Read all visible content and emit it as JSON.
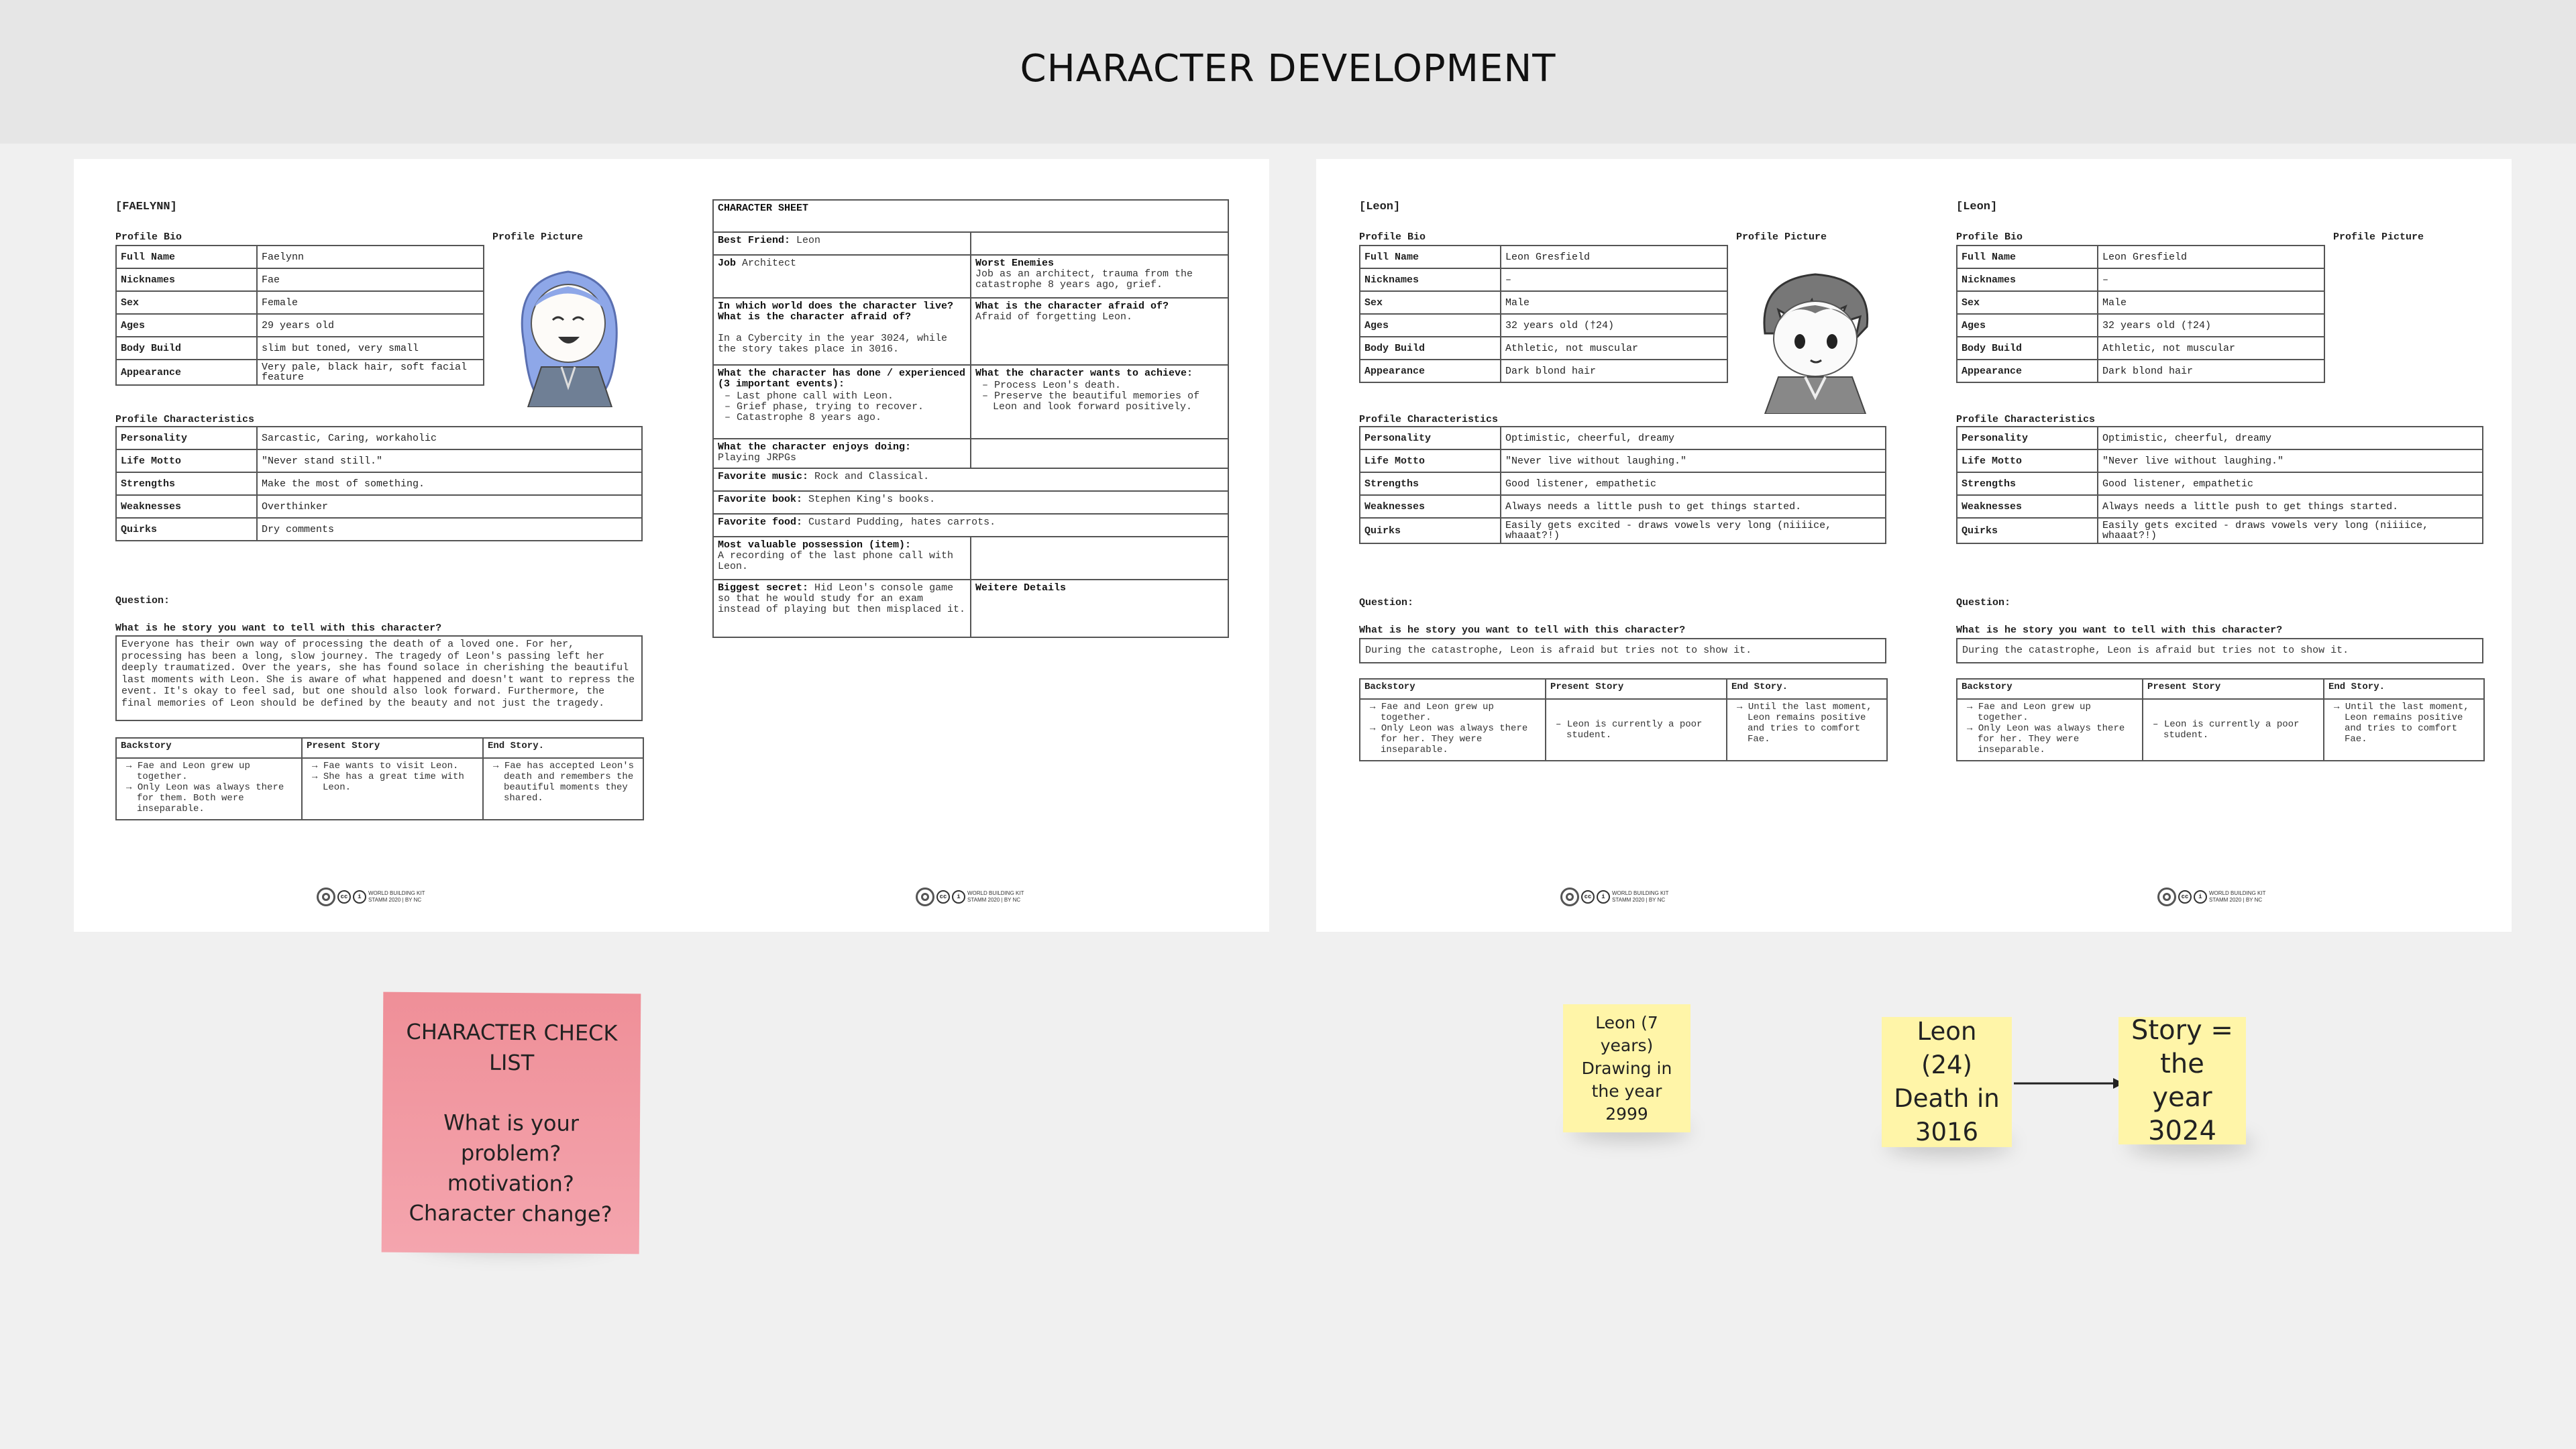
{
  "frame": {
    "title": "CHARACTER DEVELOPMENT"
  },
  "colors": {
    "sticky_pink": "#ef9aa3",
    "sticky_yellow": "#fff5a8",
    "header_bg": "#e6e6e6",
    "canvas_bg": "#f0f0f0"
  },
  "faelynn": {
    "tag": "[FAELYNN]",
    "profile_bio": "Profile Bio",
    "profile_picture": "Profile Picture",
    "bio": [
      {
        "k": "Full Name",
        "v": "Faelynn"
      },
      {
        "k": "Nicknames",
        "v": "Fae"
      },
      {
        "k": "Sex",
        "v": "Female"
      },
      {
        "k": "Ages",
        "v": "29 years old"
      },
      {
        "k": "Body Build",
        "v": "slim but toned, very small"
      },
      {
        "k": "Appearance",
        "v": "Very pale, black hair, soft facial feature"
      }
    ],
    "characteristics_label": "Profile Characteristics",
    "characteristics": [
      {
        "k": "Personality",
        "v": "Sarcastic, Caring, workaholic"
      },
      {
        "k": "Life Motto",
        "v": "\"Never stand still.\""
      },
      {
        "k": "Strengths",
        "v": "Make the most of something."
      },
      {
        "k": "Weaknesses",
        "v": "Overthinker"
      },
      {
        "k": "Quirks",
        "v": "Dry comments"
      }
    ],
    "question_label": "Question:",
    "question": "What is he story you want to tell with this character?",
    "answer": "Everyone has their own way of processing the death of a loved one. For her, processing has been a long, slow journey. The tragedy of Leon's passing left her deeply traumatized. Over the years, she has found solace in cherishing the beautiful last moments with Leon. She is aware of what happened and doesn't want to repress the event. It's okay to feel sad, but one should also look forward. Furthermore, the final memories of Leon should be defined by the beauty and not just the tragedy.",
    "story_headers": [
      "Backstory",
      "Present Story",
      "End Story."
    ],
    "backstory": [
      "Fae and Leon grew up together.",
      "Only Leon was always there for them. Both were inseparable."
    ],
    "present": [
      "Fae wants to visit Leon.",
      "She has a great time with Leon."
    ],
    "end": [
      "Fae has accepted Leon's death and remembers the beautiful moments they shared."
    ]
  },
  "sheet": {
    "title": "CHARACTER SHEET",
    "best_friend_k": "Best Friend:",
    "best_friend_v": "Leon",
    "job_k": "Job",
    "job_v": "Architect",
    "enemies_k": "Worst Enemies",
    "enemies_v": "Job as an architect, trauma from the catastrophe 8 years ago, grief.",
    "world_k": "In which world does the character live? What is the character afraid of?",
    "world_v": "In a Cybercity in the year 3024, while the story takes place in 3016.",
    "afraid_k": "What is the character afraid of?",
    "afraid_v": "Afraid of forgetting Leon.",
    "done_k": "What the character has done / experienced (3 important events):",
    "done_items": [
      "Last phone call with Leon.",
      "Grief phase, trying to recover.",
      "Catastrophe 8 years ago."
    ],
    "achieve_k": "What the character wants to achieve:",
    "achieve_items": [
      "Process Leon's death.",
      "Preserve the beautiful memories of Leon and look forward positively."
    ],
    "enjoys_k": "What the character enjoys doing:",
    "enjoys_v": "Playing JRPGs",
    "music_k": "Favorite music:",
    "music_v": "Rock and Classical.",
    "book_k": "Favorite book:",
    "book_v": "Stephen King's books.",
    "food_k": "Favorite food:",
    "food_v": "Custard Pudding, hates carrots.",
    "possession_k": "Most valuable possession (item):",
    "possession_v": "A recording of the last phone call with Leon.",
    "secret_k": "Biggest secret:",
    "secret_v": "Hid Leon's console game so that he would study for an exam instead of playing but then misplaced it.",
    "details_k": "Weitere Details"
  },
  "leon": {
    "tag": "[Leon]",
    "profile_bio": "Profile Bio",
    "profile_picture": "Profile Picture",
    "bio": [
      {
        "k": "Full Name",
        "v": "Leon Gresfield"
      },
      {
        "k": "Nicknames",
        "v": "–"
      },
      {
        "k": "Sex",
        "v": "Male"
      },
      {
        "k": "Ages",
        "v": "32 years old (†24)"
      },
      {
        "k": "Body Build",
        "v": "Athletic, not muscular"
      },
      {
        "k": "Appearance",
        "v": "Dark blond hair"
      }
    ],
    "characteristics_label": "Profile Characteristics",
    "characteristics": [
      {
        "k": "Personality",
        "v": "Optimistic, cheerful, dreamy"
      },
      {
        "k": "Life Motto",
        "v": "\"Never live without laughing.\""
      },
      {
        "k": "Strengths",
        "v": "Good listener, empathetic"
      },
      {
        "k": "Weaknesses",
        "v": "Always needs a little push to get things started."
      },
      {
        "k": "Quirks",
        "v": "Easily gets excited - draws vowels very long (niiiice, whaaat?!)"
      }
    ],
    "question_label": "Question:",
    "question": "What is he story you want to tell with this character?",
    "answer": "During the catastrophe, Leon is afraid but tries not to show it.",
    "story_headers": [
      "Backstory",
      "Present Story",
      "End Story."
    ],
    "backstory": [
      "Fae and Leon grew up together.",
      "Only Leon was always there for her. They were inseparable."
    ],
    "present": [
      "Leon is currently a poor student."
    ],
    "end": [
      "Until the last moment, Leon remains positive and tries to comfort Fae."
    ]
  },
  "footer": {
    "line1": "WORLD BUILDING KIT",
    "line2": "STAMM 2020 | BY NC"
  },
  "stickies": {
    "checklist": "CHARACTER CHECK LIST\n\nWhat is your problem? motivation? Character change?",
    "leon7": "Leon (7 years) Drawing in the year 2999",
    "leon24": "Leon (24) Death in 3016",
    "story": "Story = the year 3024"
  }
}
